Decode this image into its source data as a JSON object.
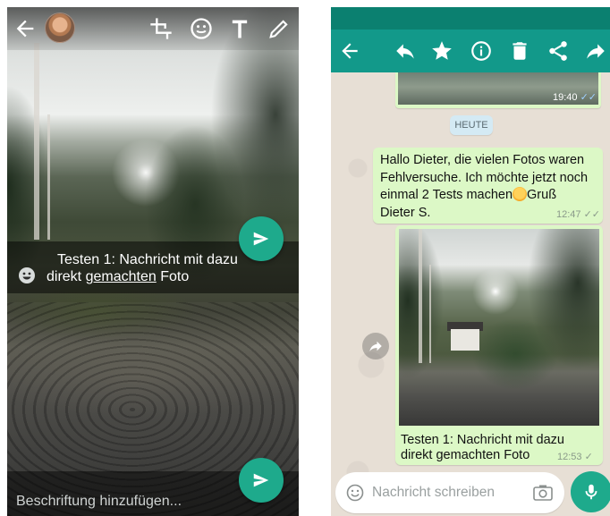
{
  "left_screen": {
    "header_icons": [
      "back-arrow-icon",
      "avatar",
      "crop-icon",
      "emoji-icon",
      "text-icon",
      "pencil-icon"
    ],
    "caption_line1_prefix": "Testen 1: Nachricht mit dazu",
    "caption_line2_a": "direkt ",
    "caption_line2_underlined": "gemachten",
    "caption_line2_b": " Foto",
    "input_placeholder": "Beschriftung hinzufügen...",
    "accent_color": "#1eaa8c"
  },
  "right_screen": {
    "action_icons": [
      "back-arrow-icon",
      "reply-icon",
      "star-icon",
      "info-icon",
      "delete-icon",
      "share-icon",
      "forward-icon"
    ],
    "previous_message_time": "19:40",
    "date_chip": "HEUTE",
    "message1": {
      "line1": "Hallo Dieter, die vielen Fotos waren",
      "line2": "Fehlversuche. Ich möchte jetzt noch",
      "line3": "einmal  2 Tests machen",
      "line3_after_emoji": "Gruß",
      "line4": "Dieter S.",
      "time": "12:47"
    },
    "message2": {
      "line1": "Testen 1: Nachricht mit dazu",
      "line2": "direkt gemachten Foto",
      "time": "12:53"
    },
    "input_placeholder": "Nachricht schreiben",
    "toolbar_color": "#12998a",
    "bubble_color": "#dcf8c6"
  }
}
